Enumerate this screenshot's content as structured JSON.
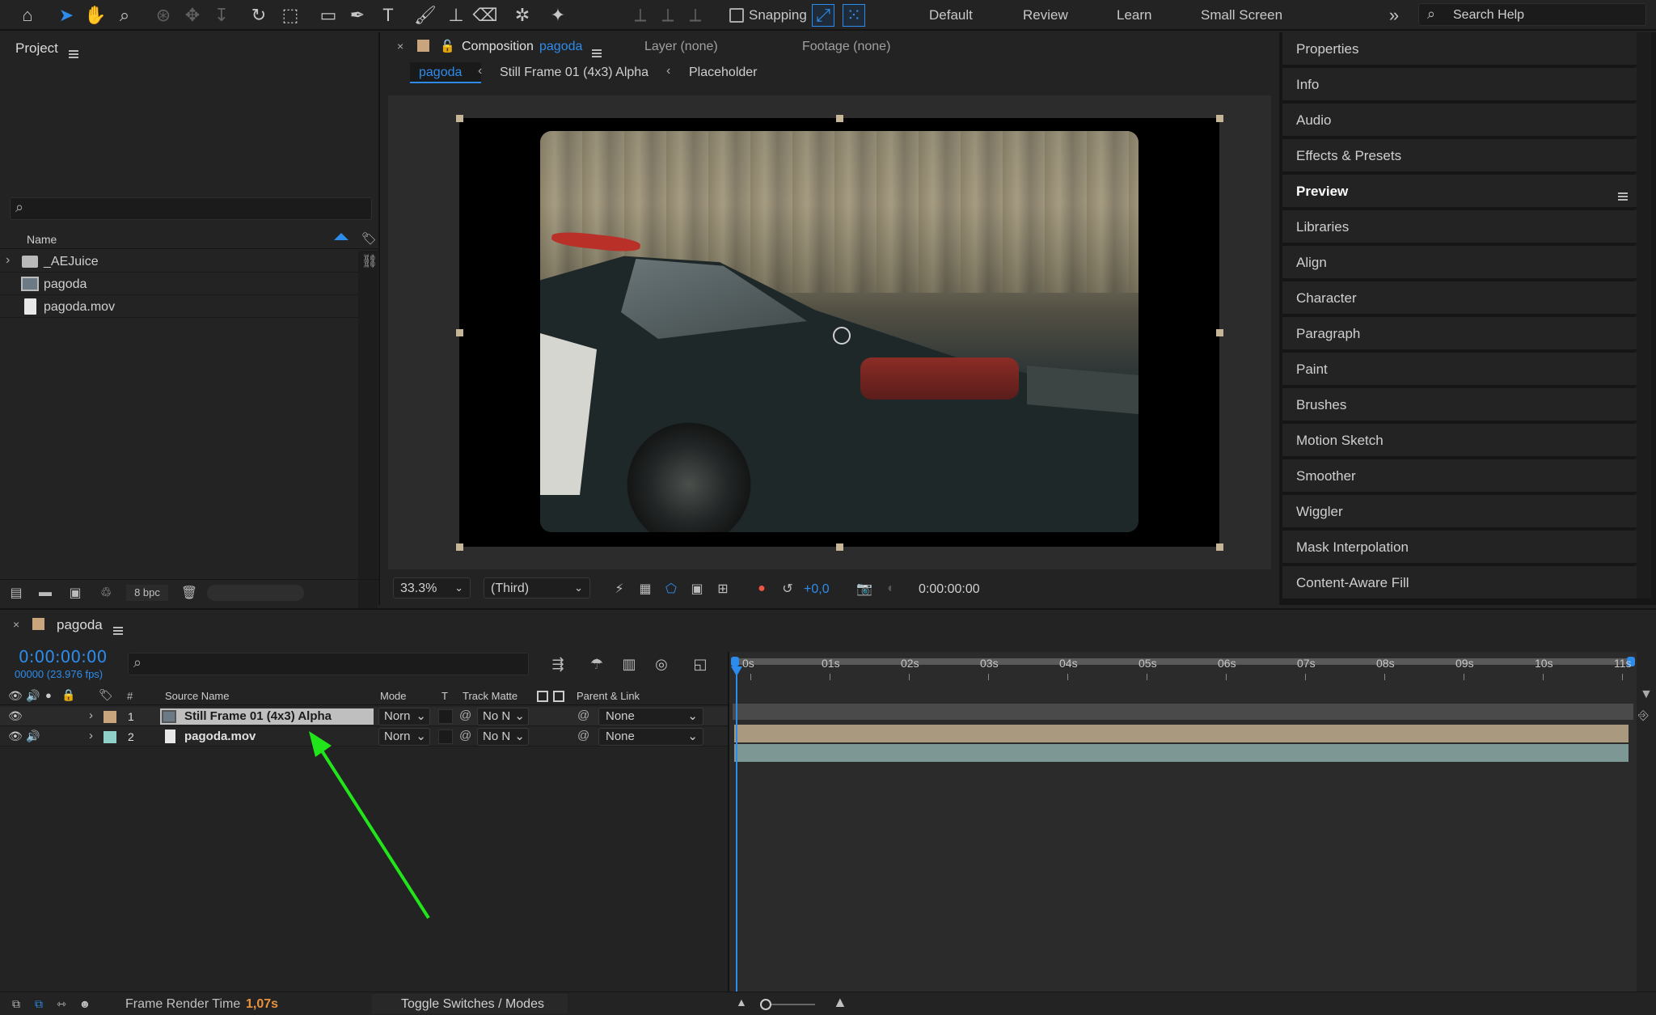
{
  "toolbar": {
    "snapping_label": "Snapping",
    "workspaces": [
      "Default",
      "Review",
      "Learn",
      "Small Screen"
    ],
    "search_placeholder": "Search Help"
  },
  "project": {
    "title": "Project",
    "column_name": "Name",
    "items": [
      {
        "name": "_AEJuice",
        "type": "folder-icon"
      },
      {
        "name": "pagoda",
        "type": "composition-icon"
      },
      {
        "name": "pagoda.mov",
        "type": "footage-icon"
      }
    ],
    "bpc": "8 bpc"
  },
  "viewer": {
    "tab_prefix": "Composition",
    "tab_comp": "pagoda",
    "layer_tab": "Layer (none)",
    "footage_tab": "Footage (none)",
    "breadcrumbs": [
      "pagoda",
      "Still Frame 01 (4x3) Alpha",
      "Placeholder"
    ],
    "zoom": "33.3%",
    "resolution": "(Third)",
    "exposure": "+0,0",
    "timecode": "0:00:00:00"
  },
  "right_panels": [
    "Properties",
    "Info",
    "Audio",
    "Effects & Presets",
    "Preview",
    "Libraries",
    "Align",
    "Character",
    "Paragraph",
    "Paint",
    "Brushes",
    "Motion Sketch",
    "Smoother",
    "Wiggler",
    "Mask Interpolation",
    "Content-Aware Fill"
  ],
  "timeline": {
    "comp_name": "pagoda",
    "timecode": "0:00:00:00",
    "frame_info": "00000 (23.976 fps)",
    "columns": {
      "source_name": "Source Name",
      "mode": "Mode",
      "t": "T",
      "track_matte": "Track Matte",
      "parent": "Parent & Link"
    },
    "layers": [
      {
        "num": "1",
        "name": "Still Frame 01 (4x3) Alpha",
        "mode": "Norn",
        "matte": "No N",
        "parent": "None",
        "label_color": "#c8a57c",
        "bar_color": "#a99a7f"
      },
      {
        "num": "2",
        "name": "pagoda.mov",
        "mode": "Norn",
        "matte": "No N",
        "parent": "None",
        "label_color": "#8fd0c9",
        "bar_color": "#7d9794"
      }
    ],
    "ruler": [
      "0s",
      "01s",
      "02s",
      "03s",
      "04s",
      "05s",
      "06s",
      "07s",
      "08s",
      "09s",
      "10s",
      "11s"
    ],
    "render_label": "Frame Render Time",
    "render_value": "1,07s",
    "toggle_label": "Toggle Switches / Modes"
  },
  "colors": {
    "accent": "#2d8ceb",
    "arrow": "#22e41a",
    "orange": "#e8923d"
  }
}
